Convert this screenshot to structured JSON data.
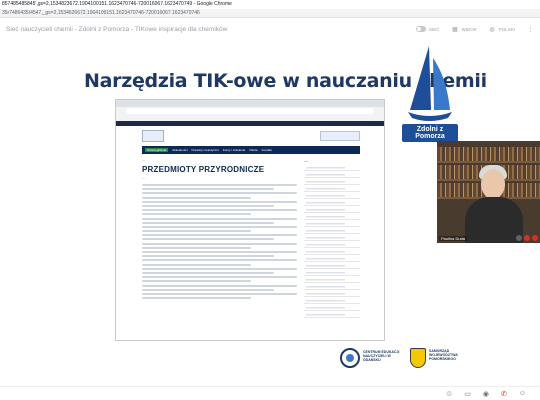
{
  "window": {
    "title": "857485485845',gs=2,1534823672.1904100151.1623470746-720016067.1623470749 - Google Chrome",
    "url": "35r7486435/4547,_gs=2,1534626672.1904109151.1623470746-720016067.1623470746"
  },
  "meeting": {
    "title": "Sieć nauczycieli chemii - Zdolni z Pomorza - TIKowe inspiracje dla chemików",
    "controls": [
      {
        "label": "SIEĆ",
        "icon": "toggle-icon"
      },
      {
        "label": "WIDOK",
        "icon": "grid-icon"
      },
      {
        "label": "POLSKI",
        "icon": "globe-icon"
      },
      {
        "label": "",
        "icon": "more-icon"
      }
    ]
  },
  "slide": {
    "title": "Narzędzia TIK-owe w nauczaniu chemii",
    "logo_text": "Zdolni z Pomorza",
    "shared_page": {
      "heading": "PRZEDMIOTY PRZYRODNICZE",
      "menu_items": [
        "Strona główna",
        "Aktualności",
        "Doradcy metodyczni",
        "Kursy i szkolenia",
        "Oferta",
        "Kontakt"
      ]
    },
    "bottom_logos": {
      "left": "CENTRUM EDUKACJI NAUCZYCIELI W GDAŃSKU",
      "right": "SAMORZĄD WOJEWÓDZTWA POMORSKIEGO"
    }
  },
  "video": {
    "name": "Paulina Duda",
    "label": "DRAW AV"
  },
  "colors": {
    "title": "#1f3864",
    "nav": "#0d2a57",
    "accent_green": "#2b8a3e",
    "logo_blue": "#1f4e99",
    "mute_red": "#d93025"
  }
}
